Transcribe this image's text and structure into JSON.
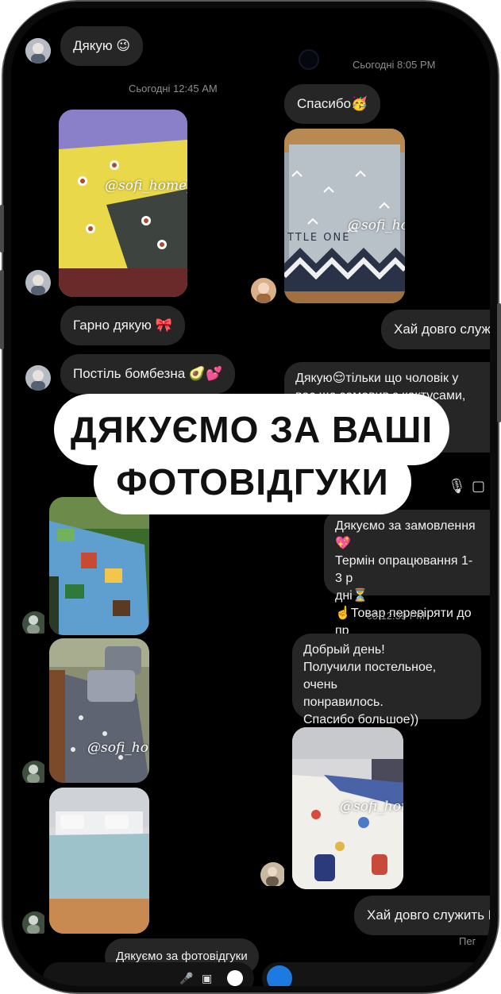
{
  "left_column": {
    "msg_thanks": "Дякую 😉",
    "stamp_1": "Сьогодні 12:45 AM",
    "msg_nice": "Гарно дякую 🎀",
    "msg_bombezna": "Постіль бомбезна 🥑💕",
    "msg_thanks_photos": "Дякуємо за фотовідгуки"
  },
  "right_column": {
    "stamp_1": "Сьогодні 8:05 PM",
    "msg_spasibo": "Спасибо🥳",
    "msg_serve": "Хай довго служ",
    "msg_husband": "Дякую😌тільки що чоловік у\nвас ще замовив з кактусами,\n   тіла з",
    "msg_order": "Дякуємо за замовлення💖\nТермін опрацювання 1-3 р\nдні⏳\n☝️Товар перевіряти до пр",
    "stamp_2": "сб 12:39 PM",
    "msg_review": "Добрый день!\nПолучили постельное, очень\nпонравилось.\nСпасибо большое))",
    "msg_serve2": "Хай довго служить Е",
    "stamp_3": "Пег"
  },
  "watermark": "@sofi_home_night",
  "watermark_partial": "TTLE ONE",
  "banner": {
    "line1": "ДЯКУЄМО ЗА ВАШІ",
    "line2": "ФОТОВІДГУКИ"
  },
  "icons": [
    "mic-icon",
    "gallery-icon",
    "camera-icon",
    "plus-icon",
    "sticker-icon"
  ],
  "colors": {
    "background": "#000000",
    "bubble": "#262626",
    "text": "#f2f2f2",
    "timestamp": "#8e8e8e",
    "banner": "#ffffff"
  }
}
